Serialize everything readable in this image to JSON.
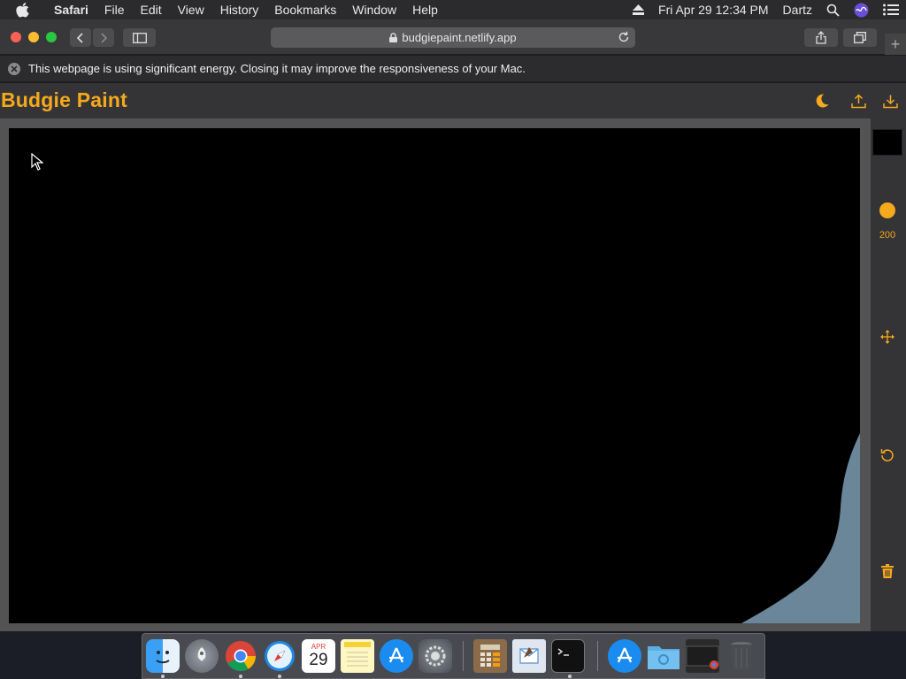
{
  "menubar": {
    "app_name": "Safari",
    "items": [
      "File",
      "Edit",
      "View",
      "History",
      "Bookmarks",
      "Window",
      "Help"
    ],
    "datetime": "Fri Apr 29  12:34 PM",
    "user": "Dartz"
  },
  "browser": {
    "url": "budgiepaint.netlify.app",
    "energy_warning": "This webpage is using significant energy. Closing it may improve the responsiveness of your Mac."
  },
  "app": {
    "title": "Budgie Paint",
    "accent_color": "#f5a91c",
    "current_color": "#000000",
    "brush_size": "200",
    "header_icons": [
      "moon-icon",
      "upload-icon",
      "download-icon"
    ],
    "tool_icons": [
      "move-icon",
      "undo-icon",
      "trash-icon"
    ]
  },
  "dock": {
    "calendar_month": "APR",
    "calendar_day": "29",
    "apps": [
      "Finder",
      "Launchpad",
      "Chrome",
      "Safari",
      "Calendar",
      "Notes",
      "App Store",
      "System Preferences",
      "Calculator",
      "Mail",
      "Terminal",
      "App Store",
      "Folder",
      "Chrome Window",
      "Trash"
    ]
  }
}
